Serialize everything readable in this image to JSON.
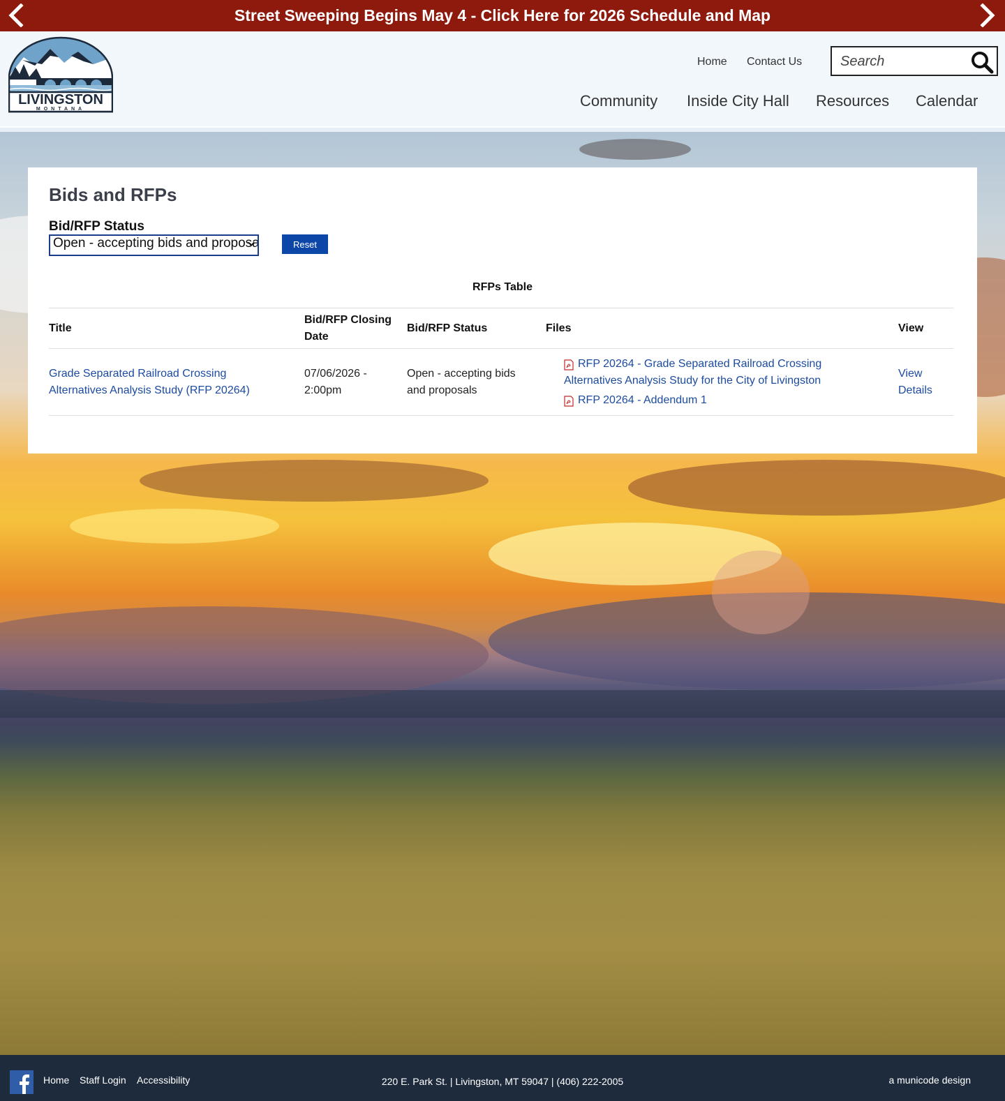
{
  "alert": {
    "text": "Street Sweeping Begins May 4 - Click Here for 2026 Schedule and Map"
  },
  "logo": {
    "name": "LIVINGSTON",
    "sub": "MONTANA"
  },
  "utility_nav": {
    "home": "Home",
    "contact": "Contact Us"
  },
  "search": {
    "placeholder": "Search"
  },
  "main_nav": {
    "community": "Community",
    "inside_city_hall": "Inside City Hall",
    "resources": "Resources",
    "calendar": "Calendar"
  },
  "page": {
    "title": "Bids and RFPs",
    "filter_label": "Bid/RFP Status",
    "filter_value": "Open - accepting bids and proposals",
    "reset_label": "Reset",
    "table_caption": "RFPs Table"
  },
  "table": {
    "headers": {
      "title": "Title",
      "closing": "Bid/RFP Closing Date",
      "status": "Bid/RFP Status",
      "files": "Files",
      "view": "View"
    },
    "rows": [
      {
        "title": "Grade Separated Railroad Crossing Alternatives Analysis Study (RFP 20264)",
        "closing": "07/06/2026 - 2:00pm",
        "status": "Open - accepting bids and proposals",
        "files": [
          "RFP 20264 - Grade Separated Railroad Crossing Alternatives Analysis Study for the City of Livingston",
          "RFP 20264 - Addendum 1"
        ],
        "view": "View Details"
      }
    ]
  },
  "footer": {
    "home": "Home",
    "staff_login": "Staff Login",
    "accessibility": "Accessibility",
    "address": "220 E. Park St. | Livingston, MT 59047 | (406) 222-2005",
    "credit": "a municode design"
  },
  "colors": {
    "alert_bg": "#8e1a0e",
    "link": "#1c4ba0",
    "button": "#0c47a8",
    "footer_bg": "#1e2b3d"
  }
}
